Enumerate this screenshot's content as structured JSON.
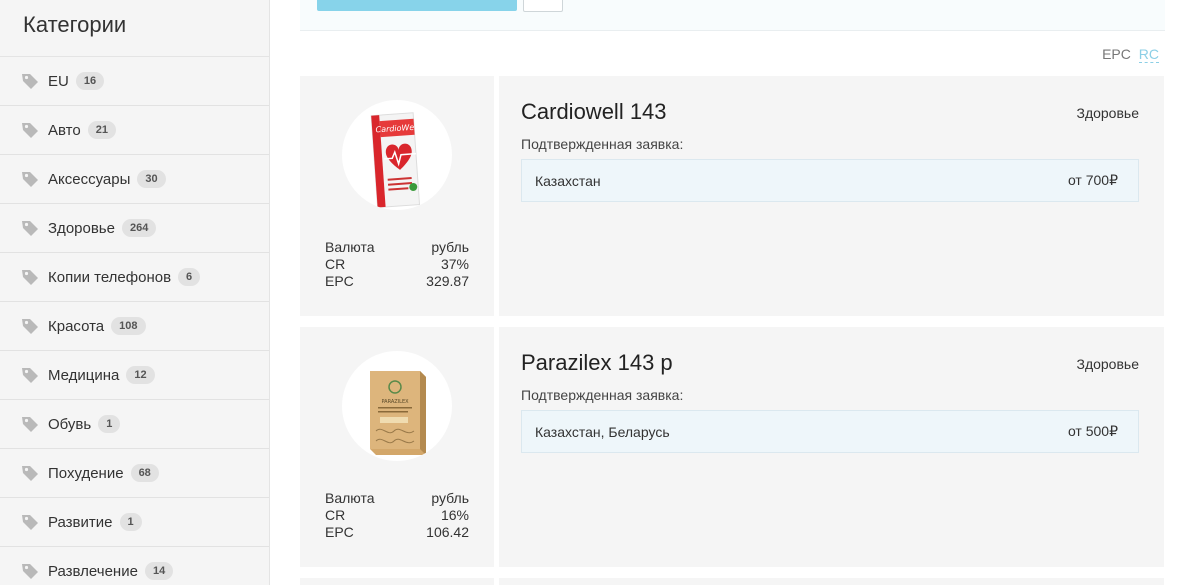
{
  "sidebar": {
    "title": "Категории",
    "items": [
      {
        "label": "EU",
        "count": "16"
      },
      {
        "label": "Авто",
        "count": "21"
      },
      {
        "label": "Аксессуары",
        "count": "30"
      },
      {
        "label": "Здоровье",
        "count": "264"
      },
      {
        "label": "Копии телефонов",
        "count": "6"
      },
      {
        "label": "Красота",
        "count": "108"
      },
      {
        "label": "Медицина",
        "count": "12"
      },
      {
        "label": "Обувь",
        "count": "1"
      },
      {
        "label": "Похудение",
        "count": "68"
      },
      {
        "label": "Развитие",
        "count": "1"
      },
      {
        "label": "Развлечение",
        "count": "14"
      }
    ],
    "icon": "tag-icon"
  },
  "sort": {
    "epc_label": "EPC",
    "rc_label": "RC"
  },
  "offers": [
    {
      "title": "Cardiowell 143",
      "category": "Здоровье",
      "subtitle": "Подтвержденная заявка:",
      "geo": "Казахстан",
      "price": "от 700₽",
      "stats": {
        "currency_label": "Валюта",
        "currency_value": "рубль",
        "cr_label": "CR",
        "cr_value": "37%",
        "epc_label": "EPC",
        "epc_value": "329.87"
      },
      "image_text": "CardioWell"
    },
    {
      "title": "Parazilex 143 р",
      "category": "Здоровье",
      "subtitle": "Подтвержденная заявка:",
      "geo": "Казахстан, Беларусь",
      "price": "от 500₽",
      "stats": {
        "currency_label": "Валюта",
        "currency_value": "рубль",
        "cr_label": "CR",
        "cr_value": "16%",
        "epc_label": "EPC",
        "epc_value": "106.42"
      },
      "image_text": "PARAZILEX"
    }
  ],
  "colors": {
    "accent": "#87d3ea",
    "rc_link": "#8ccfe6",
    "card_bg": "#f5f5f5",
    "geo_bg": "#eef6fa"
  }
}
